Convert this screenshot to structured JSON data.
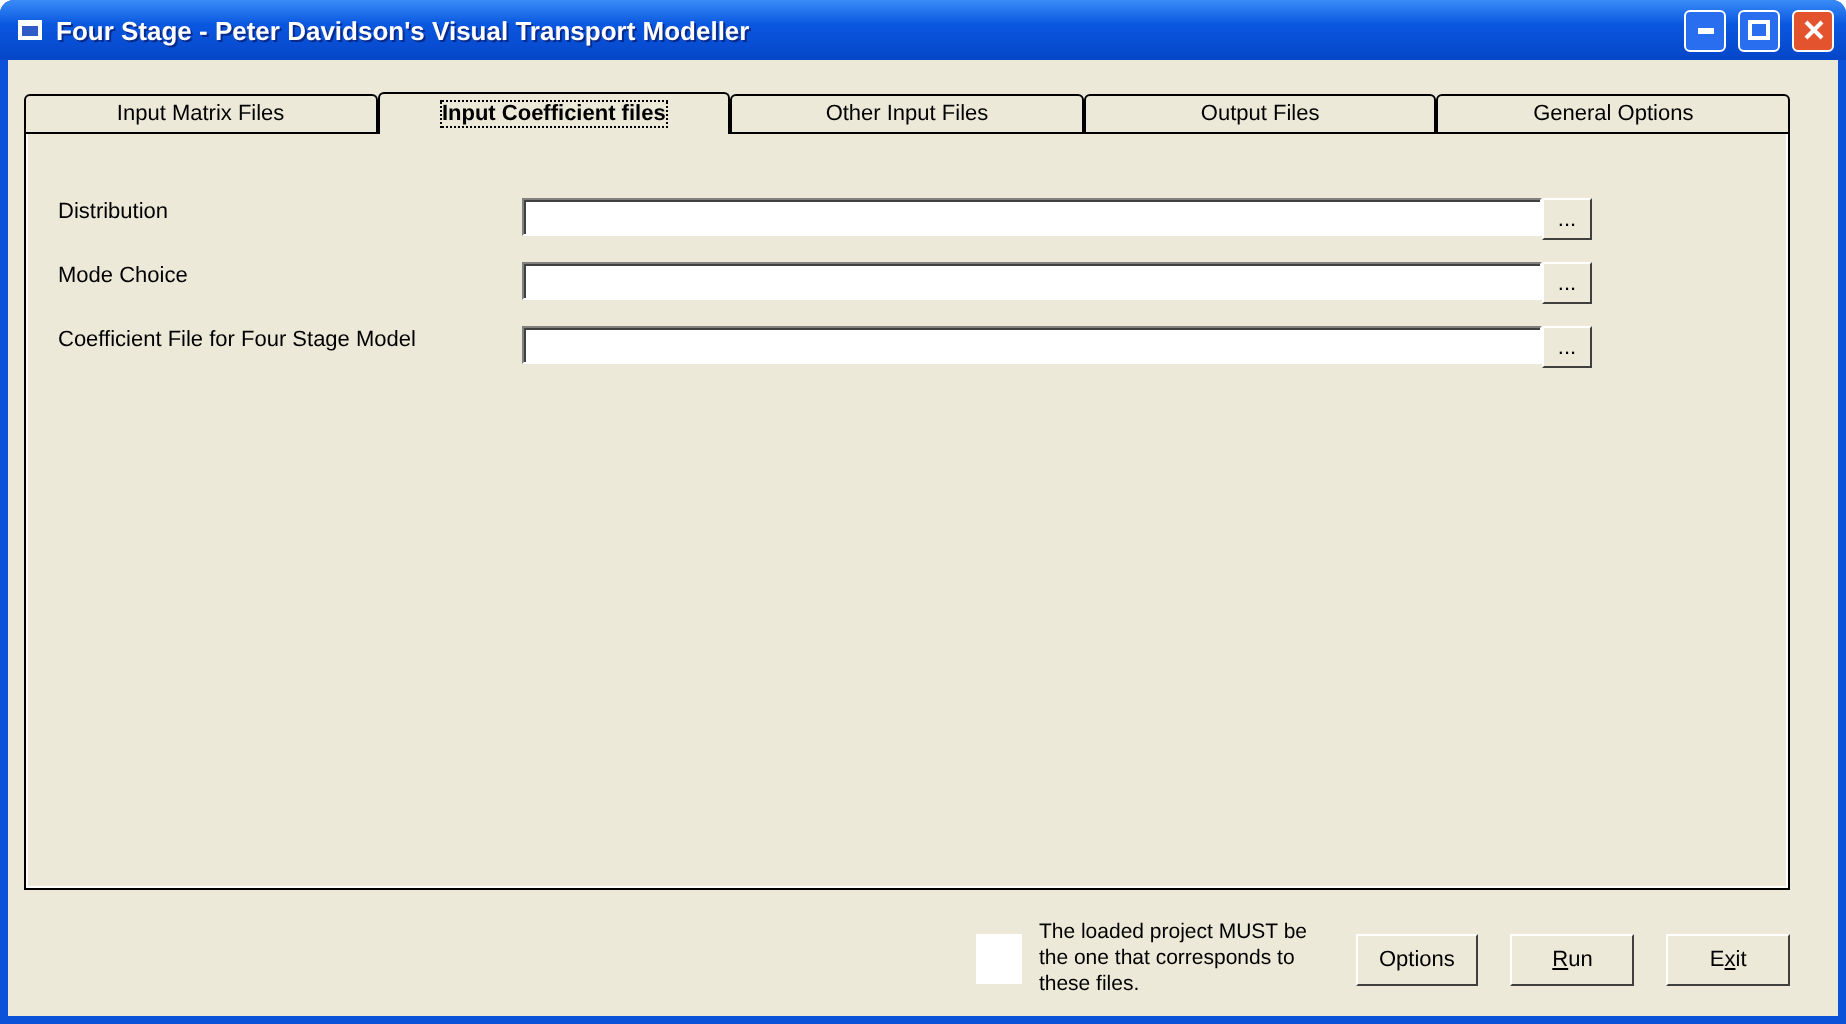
{
  "window": {
    "title": "Four Stage - Peter Davidson's Visual Transport Modeller"
  },
  "tabs": [
    {
      "label": "Input Matrix Files",
      "selected": false
    },
    {
      "label": "Input Coefficient files",
      "selected": true
    },
    {
      "label": "Other Input Files",
      "selected": false
    },
    {
      "label": "Output Files",
      "selected": false
    },
    {
      "label": "General Options",
      "selected": false
    }
  ],
  "fields": [
    {
      "label": "Distribution",
      "browse": "..."
    },
    {
      "label": "Mode Choice",
      "browse": "..."
    },
    {
      "label": "Coefficient File for Four Stage Model",
      "browse": "..."
    }
  ],
  "note": "The loaded project MUST be the one that corresponds to these files.",
  "buttons": [
    {
      "before": "Options"
    },
    {
      "key": "R",
      "after": "un"
    },
    {
      "before": "E",
      "key": "x",
      "after": "it"
    }
  ]
}
